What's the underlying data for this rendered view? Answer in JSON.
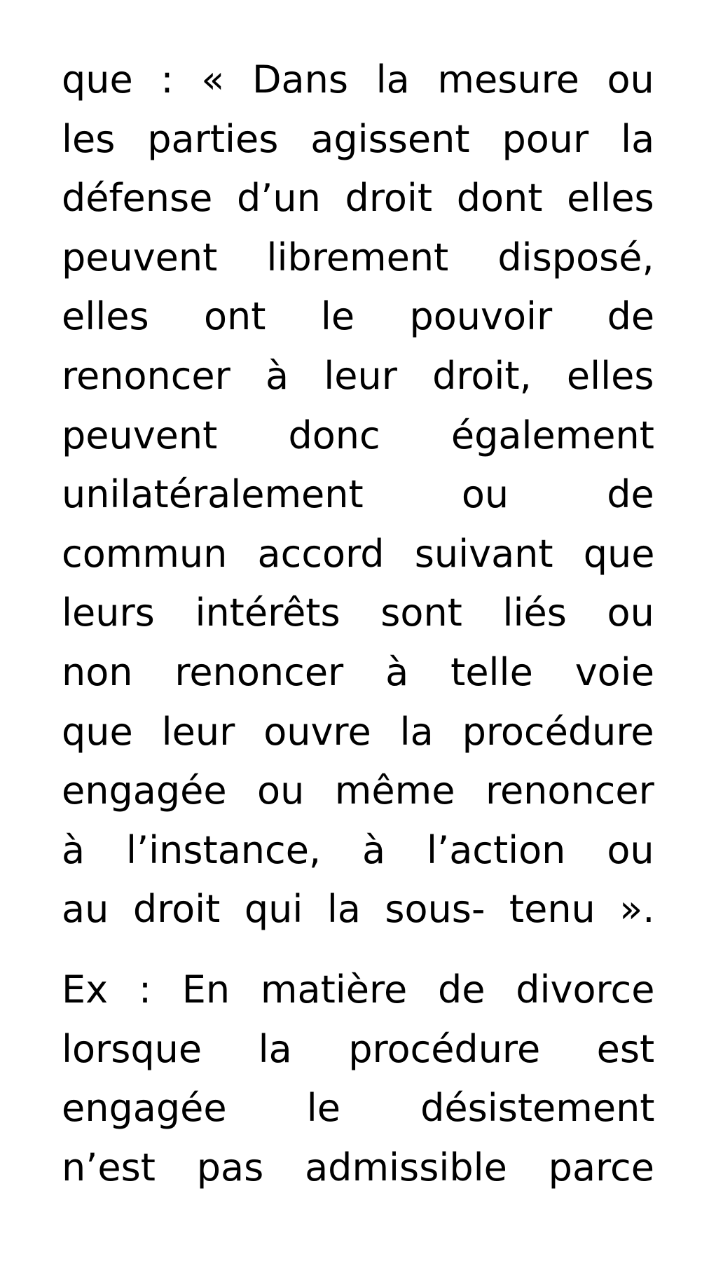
{
  "paragraphs": [
    {
      "lines": [
        "que : « Dans la mesure  ou",
        "les parties agissent pour la",
        "défense d’un droit dont elles",
        "peuvent librement disposé,",
        "elles ont le pouvoir de",
        "renoncer à leur droit, elles",
        "peuvent donc également",
        "unilatéralement ou de",
        "commun accord suivant que",
        "leurs intérêts sont liés ou",
        "non renoncer à telle voie",
        "que leur ouvre la procédure",
        "engagée ou même renoncer",
        "à l’instance, à l’action ou",
        "au droit qui la sous- tenu »."
      ]
    },
    {
      "lines": [
        "Ex : En matière de divorce",
        "lorsque la procédure est",
        "engagée le désistement",
        "n’est pas admissible parce"
      ]
    }
  ]
}
